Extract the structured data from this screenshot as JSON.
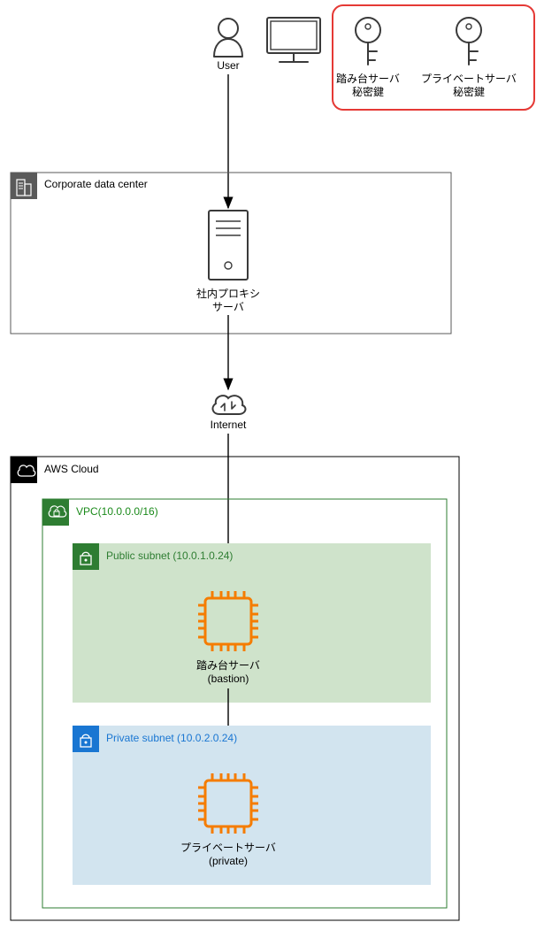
{
  "user": {
    "label": "User"
  },
  "keys": {
    "bastion_key_l1": "踏み台サーバ",
    "bastion_key_l2": "秘密鍵",
    "private_key_l1": "プライベートサーバ",
    "private_key_l2": "秘密鍵"
  },
  "datacenter": {
    "title": "Corporate data center",
    "proxy_l1": "社内プロキシ",
    "proxy_l2": "サーバ"
  },
  "internet": {
    "label": "Internet"
  },
  "aws": {
    "title": "AWS Cloud",
    "vpc_title": "VPC(10.0.0.0/16)",
    "public_subnet_title": "Public subnet (10.0.1.0.24)",
    "private_subnet_title": "Private subnet (10.0.2.0.24)",
    "bastion_l1": "踏み台サーバ",
    "bastion_l2": "(bastion)",
    "private_l1": "プライベートサーバ",
    "private_l2": "(private)"
  }
}
